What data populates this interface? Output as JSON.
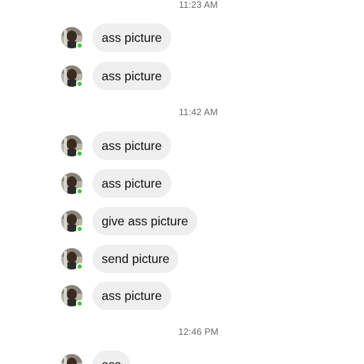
{
  "conversation": {
    "timestamps": [
      "11:23 AM",
      "11:42 AM",
      "12:46 PM"
    ],
    "messages": [
      {
        "text": "ass picture"
      },
      {
        "text": "ass picture"
      },
      {
        "text": "ass picture"
      },
      {
        "text": "ass picture"
      },
      {
        "text": "give ass picture"
      },
      {
        "text": "send picture"
      },
      {
        "text": "ass picture"
      },
      {
        "text": "ass"
      }
    ]
  },
  "colors": {
    "bubble": "#efefef",
    "presence": "#44c43f",
    "timestamp": "#6b6b6b"
  }
}
